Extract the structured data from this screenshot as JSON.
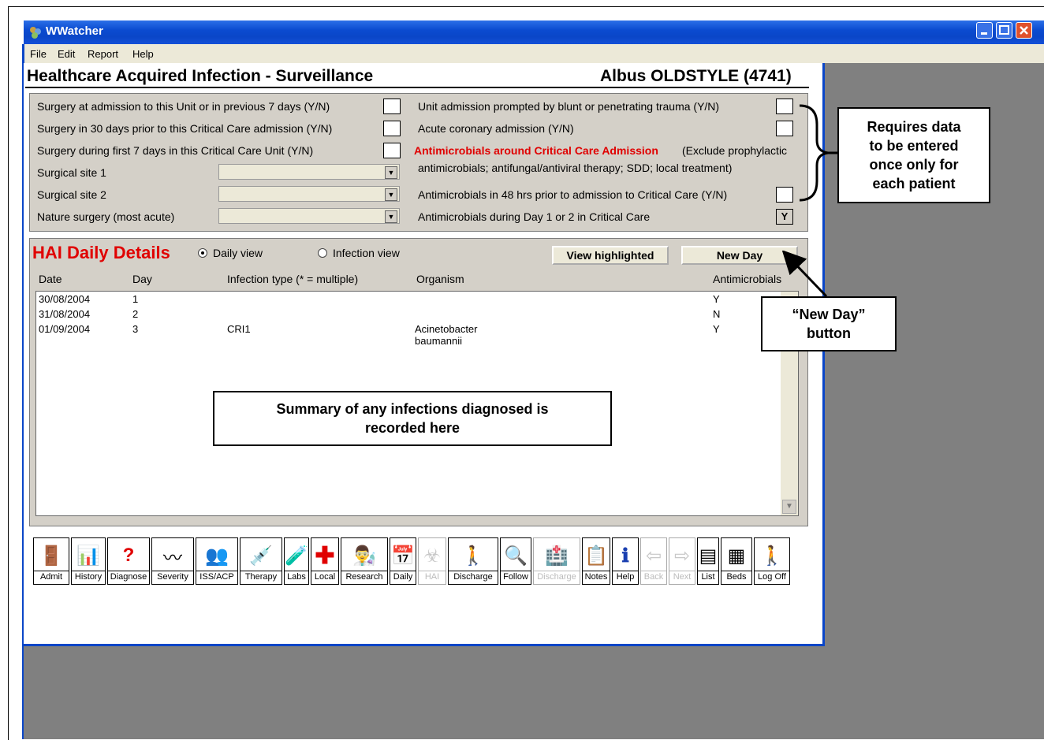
{
  "window": {
    "title": "WWatcher"
  },
  "menu": [
    "File",
    "Edit",
    "Report",
    "Help"
  ],
  "header": {
    "title": "Healthcare Acquired Infection - Surveillance",
    "patient": "Albus OLDSTYLE (4741)"
  },
  "surgery": {
    "q1": "Surgery at admission to this Unit or in previous 7 days  (Y/N)",
    "q2": "Surgery in 30 days prior to this Critical Care admission  (Y/N)",
    "q3": "Surgery during first 7 days in this Critical Care Unit  (Y/N)",
    "site1": "Surgical site 1",
    "site2": "Surgical site 2",
    "nature": "Nature surgery (most acute)"
  },
  "admission": {
    "trauma": "Unit admission prompted by blunt or penetrating trauma (Y/N)",
    "coronary": "Acute coronary admission  (Y/N)",
    "antimicrobials_heading": "Antimicrobials around Critical Care Admission",
    "antimicrobials_note1": "(Exclude prophylactic",
    "antimicrobials_note2": "antimicrobials; antifungal/antiviral therapy; SDD; local treatment)",
    "prior48": "Antimicrobials in 48 hrs prior to admission to Critical Care (Y/N)",
    "day12": "Antimicrobials during Day 1 or 2 in Critical Care",
    "day12_value": "Y"
  },
  "callouts": {
    "data_once": [
      "Requires data",
      "to be entered",
      "once only for",
      "each patient"
    ],
    "new_day": [
      "“New Day”",
      "button"
    ],
    "summary": [
      "Summary of any infections diagnosed is",
      "recorded here"
    ]
  },
  "daily": {
    "title": "HAI Daily Details",
    "radio_daily": "Daily view",
    "radio_infection": "Infection view",
    "view_highlighted": "View highlighted",
    "new_day": "New Day",
    "columns": {
      "date": "Date",
      "day": "Day",
      "infection": "Infection type (* = multiple)",
      "organism": "Organism",
      "antimicrobials": "Antimicrobials"
    },
    "rows": [
      {
        "date": "30/08/2004",
        "day": "1",
        "infection": "",
        "organism": "",
        "antimicrobials": "Y"
      },
      {
        "date": "31/08/2004",
        "day": "2",
        "infection": "",
        "organism": "",
        "antimicrobials": "N"
      },
      {
        "date": "01/09/2004",
        "day": "3",
        "infection": "CRI1",
        "organism": "Acinetobacter baumannii",
        "antimicrobials": "Y"
      }
    ]
  },
  "toolbar": [
    {
      "label": "Admit",
      "icon": "admit-icon",
      "glyph": "🚪"
    },
    {
      "label": "History",
      "icon": "history-icon",
      "glyph": "📊"
    },
    {
      "label": "Diagnose",
      "icon": "diagnose-icon",
      "glyph": "?"
    },
    {
      "label": "Severity",
      "icon": "severity-icon",
      "glyph": "〰"
    },
    {
      "label": "ISS/ACP",
      "icon": "iss-acp-icon",
      "glyph": "👥"
    },
    {
      "label": "Therapy",
      "icon": "therapy-icon",
      "glyph": "💉"
    },
    {
      "label": "Labs",
      "icon": "labs-icon",
      "glyph": "🧪"
    },
    {
      "label": "Local",
      "icon": "local-icon",
      "glyph": "✚"
    },
    {
      "label": "Research",
      "icon": "research-icon",
      "glyph": "👨‍🔬"
    },
    {
      "label": "Daily",
      "icon": "daily-icon",
      "glyph": "📅"
    },
    {
      "label": "HAI",
      "icon": "hai-icon",
      "glyph": "☣",
      "disabled": true
    },
    {
      "label": "Discharge",
      "icon": "discharge-icon",
      "glyph": "🚶"
    },
    {
      "label": "Follow",
      "icon": "follow-icon",
      "glyph": "🔍"
    },
    {
      "label": "Discharge",
      "icon": "hospital-discharge-icon",
      "glyph": "🏥",
      "disabled": true
    },
    {
      "label": "Notes",
      "icon": "notes-icon",
      "glyph": "📋"
    },
    {
      "label": "Help",
      "icon": "help-icon",
      "glyph": "ℹ"
    },
    {
      "label": "Back",
      "icon": "back-arrow-icon",
      "glyph": "⇦",
      "disabled": true
    },
    {
      "label": "Next",
      "icon": "next-arrow-icon",
      "glyph": "⇨",
      "disabled": true
    },
    {
      "label": "List",
      "icon": "list-icon",
      "glyph": "▤"
    },
    {
      "label": "Beds",
      "icon": "beds-icon",
      "glyph": "▦"
    },
    {
      "label": "Log Off",
      "icon": "log-off-icon",
      "glyph": "🚶"
    }
  ]
}
